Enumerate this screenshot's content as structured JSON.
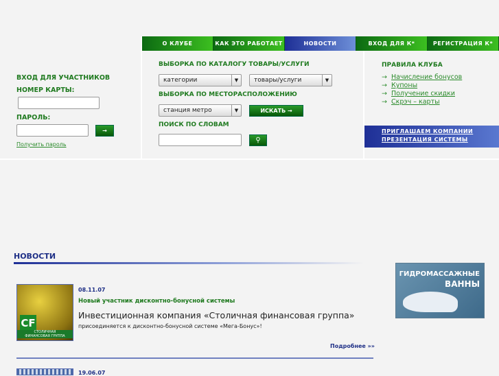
{
  "nav": [
    "О КЛУБЕ",
    "КАК ЭТО РАБОТАЕТ",
    "НОВОСТИ",
    "ВХОД ДЛЯ К*",
    "РЕГИСТРАЦИЯ К*"
  ],
  "login": {
    "title": "ВХОД ДЛЯ УЧАСТНИКОВ",
    "card_label": "НОМЕР КАРТЫ:",
    "pass_label": "ПАРОЛЬ:",
    "submit": "→",
    "get_password": "Получить пароль"
  },
  "search": {
    "catalog_title": "ВЫБОРКА ПО КАТАЛОГУ ТОВАРЫ/УСЛУГИ",
    "categories": "категории",
    "goods": "товары/услуги",
    "location_title": "ВЫБОРКА ПО МЕСТОРАСПОЛОЖЕНИЮ",
    "metro": "станция метро",
    "find": "ИСКАТЬ →",
    "words_title": "ПОИСК ПО СЛОВАМ"
  },
  "rules": {
    "title": "ПРАВИЛА КЛУБА",
    "items": [
      "Начисление бонусов",
      "Купоны",
      "Получение скидки",
      "Скрэч – карты"
    ]
  },
  "promo": [
    "ПРИГЛАШАЕМ КОМПАНИИ",
    "ПРЕЗЕНТАЦИЯ СИСТЕМЫ"
  ],
  "news": {
    "title": "НОВОСТИ",
    "items": [
      {
        "date": "08.11.07",
        "headline": "Новый участник дисконтно-бонусной системы",
        "lead": "Инвестиционная компания «Столичная финансовая группа»",
        "text": "присоединяется к дисконтно-бонусной системе «Мега-Бонус»!",
        "more": "Подробнее »»",
        "logo": "СТОЛИЧНАЯ ФИНАНСОВАЯ ГРУППА"
      },
      {
        "date": "19.06.07"
      }
    ]
  },
  "banner": [
    "ГИДРОМАССАЖНЫЕ",
    "ВАННЫ"
  ]
}
